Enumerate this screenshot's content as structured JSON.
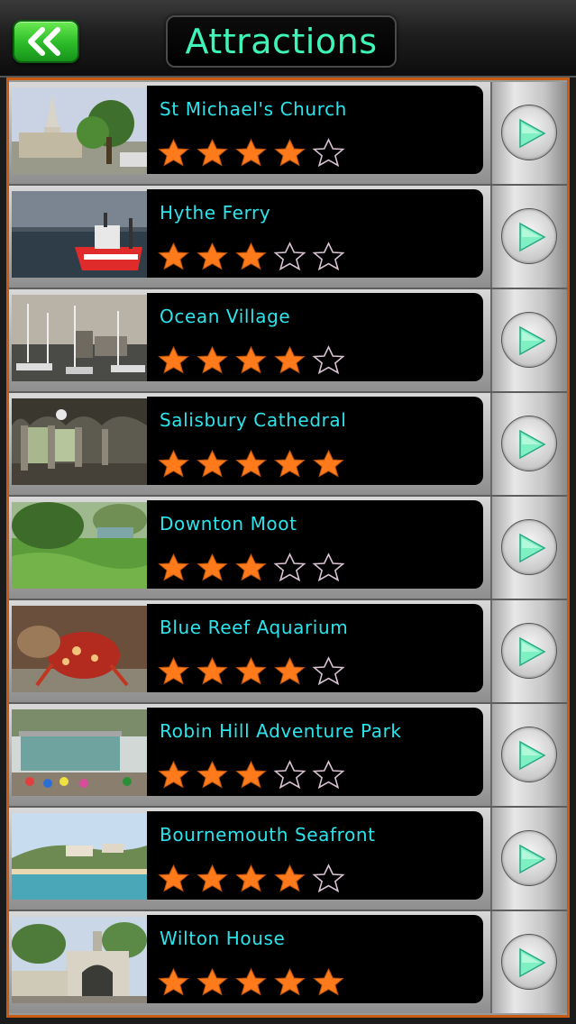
{
  "header": {
    "title": "Attractions",
    "back_icon": "double-chevron-left-icon",
    "accent": "#3ef5b9",
    "back_color": "#2fbf2b"
  },
  "list": {
    "border_color": "#c85a13",
    "title_color": "#2be4ec",
    "star_color": "#ff7a1a",
    "items": [
      {
        "title": "St Michael's Church",
        "rating": 4,
        "max_rating": 5
      },
      {
        "title": "Hythe Ferry",
        "rating": 3,
        "max_rating": 5
      },
      {
        "title": "Ocean Village",
        "rating": 4,
        "max_rating": 5
      },
      {
        "title": "Salisbury Cathedral",
        "rating": 5,
        "max_rating": 5
      },
      {
        "title": "Downton Moot",
        "rating": 3,
        "max_rating": 5
      },
      {
        "title": "Blue Reef Aquarium",
        "rating": 4,
        "max_rating": 5
      },
      {
        "title": "Robin Hill Adventure Park",
        "rating": 3,
        "max_rating": 5
      },
      {
        "title": "Bournemouth Seafront",
        "rating": 4,
        "max_rating": 5
      },
      {
        "title": "Wilton House",
        "rating": 5,
        "max_rating": 5
      }
    ]
  }
}
